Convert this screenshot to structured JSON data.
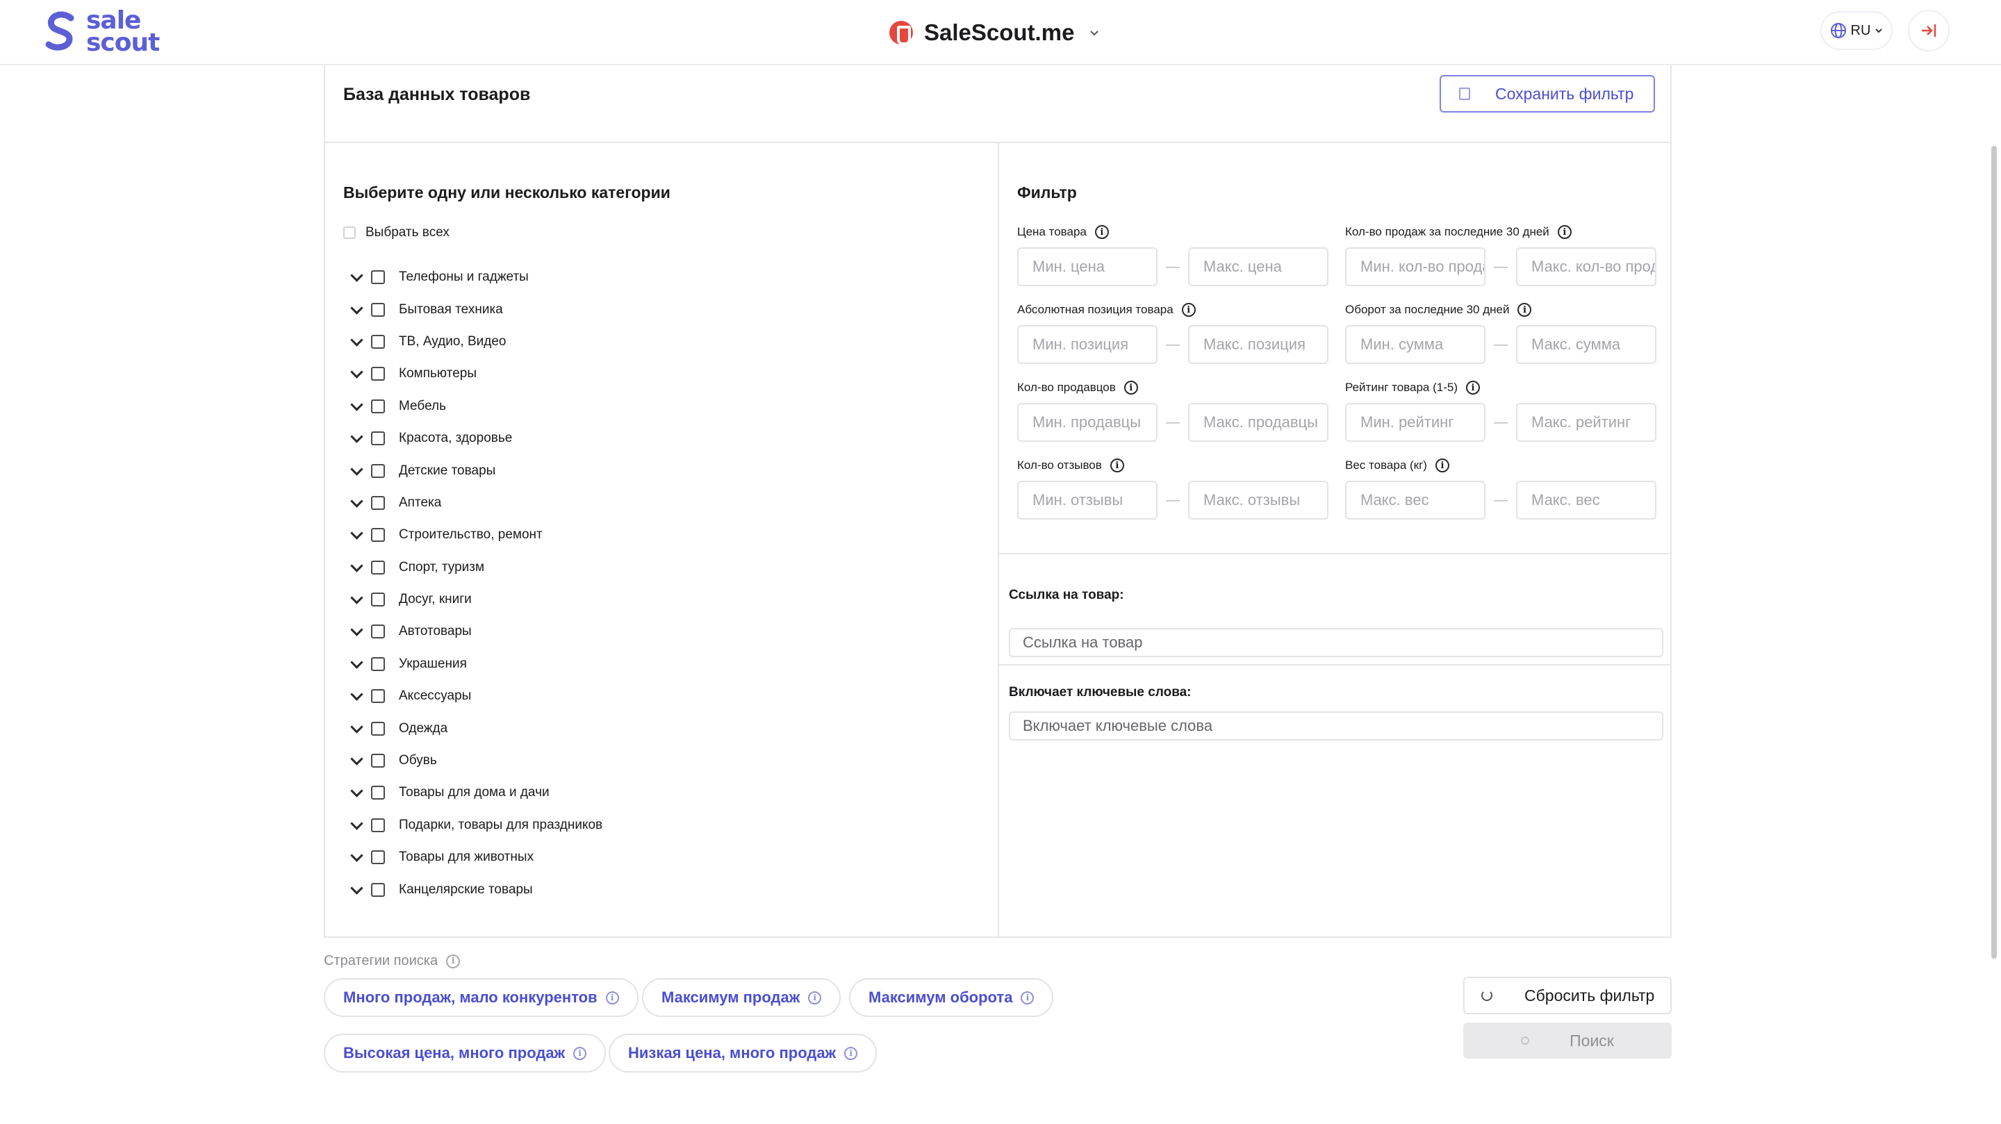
{
  "header": {
    "logo_text_1": "sale",
    "logo_text_2": "scout",
    "brand_name": "SaleScout.me",
    "language": "RU",
    "accent_color": "#5c5fd6",
    "brand_icon_color": "#e5483d"
  },
  "page": {
    "title": "База данных товаров",
    "save_filter_label": "Сохранить фильтр"
  },
  "categories": {
    "title": "Выберите одну или несколько категории",
    "select_all_label": "Выбрать всех",
    "items": [
      "Телефоны и гаджеты",
      "Бытовая техника",
      "ТВ, Аудио, Видео",
      "Компьютеры",
      "Мебель",
      "Красота, здоровье",
      "Детские товары",
      "Аптека",
      "Строительство, ремонт",
      "Спорт, туризм",
      "Досуг, книги",
      "Автотовары",
      "Украшения",
      "Аксессуары",
      "Одежда",
      "Обувь",
      "Товары для дома и дачи",
      "Подарки, товары для праздников",
      "Товары для животных",
      "Канцелярские товары"
    ]
  },
  "filter": {
    "title": "Фильтр",
    "groups": [
      {
        "label": "Цена товара",
        "min_placeholder": "Мин. цена",
        "max_placeholder": "Макс. цена"
      },
      {
        "label": "Кол-во продаж за последние 30 дней",
        "min_placeholder": "Мин. кол-во продаж",
        "max_placeholder": "Макс. кол-во продаж"
      },
      {
        "label": "Абсолютная позиция товара",
        "min_placeholder": "Мин. позиция",
        "max_placeholder": "Макс. позиция"
      },
      {
        "label": "Оборот за последние 30 дней",
        "min_placeholder": "Мин. сумма",
        "max_placeholder": "Макс. сумма"
      },
      {
        "label": "Кол-во продавцов",
        "min_placeholder": "Мин. продавцы",
        "max_placeholder": "Макс. продавцы"
      },
      {
        "label": "Рейтинг товара (1-5)",
        "min_placeholder": "Мин. рейтинг",
        "max_placeholder": "Макс. рейтинг"
      },
      {
        "label": "Кол-во отзывов",
        "min_placeholder": "Мин. отзывы",
        "max_placeholder": "Макс. отзывы"
      },
      {
        "label": "Вес товара (кг)",
        "min_placeholder": "Макс. вес",
        "max_placeholder": "Макс. вес"
      }
    ],
    "dash": "—",
    "link_label": "Ссылка на товар:",
    "link_placeholder": "Ссылка на товар",
    "keywords_label": "Включает ключевые слова:",
    "keywords_placeholder": "Включает ключевые слова"
  },
  "strategies": {
    "label": "Стратегии поиска",
    "items": [
      "Много продаж, мало конкурентов",
      "Максимум продаж",
      "Максимум оборота",
      "Высокая цена, много продаж",
      "Низкая цена, много продаж"
    ]
  },
  "actions": {
    "reset_label": "Сбросить фильтр",
    "search_label": "Поиск"
  }
}
